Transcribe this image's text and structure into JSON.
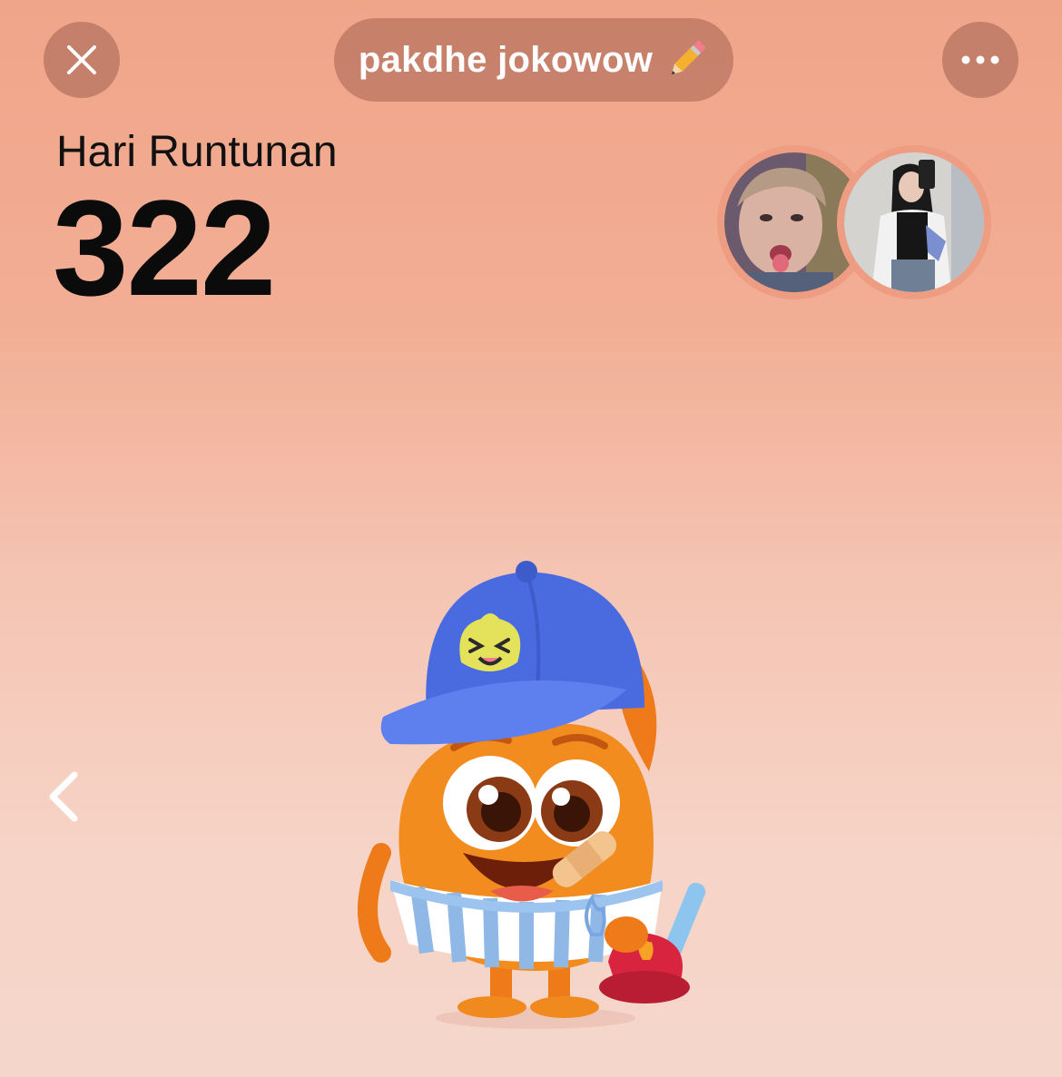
{
  "header": {
    "close_icon": "close-icon",
    "username": "pakdhe jokowow",
    "edit_icon": "pencil-icon",
    "more_icon": "more-horizontal-icon"
  },
  "streak": {
    "label": "Hari Runtunan",
    "days": "322"
  },
  "friends": {
    "avatars": [
      "friend-avatar-1",
      "friend-avatar-2"
    ]
  },
  "navigation": {
    "prev_icon": "chevron-left-icon"
  },
  "colors": {
    "background_top": "#F0A589",
    "background_bottom": "#F5D6CB",
    "button_bg": "#A56252",
    "text_dark": "#111111",
    "mascot_orange": "#F08A1E",
    "cap_blue": "#4A6BE0"
  }
}
